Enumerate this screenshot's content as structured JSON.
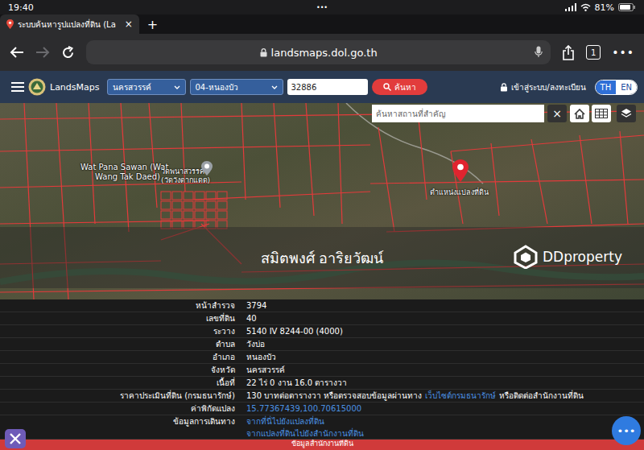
{
  "status_bar": {
    "time": "19:40",
    "dots": "•••",
    "battery": "81%"
  },
  "browser": {
    "tab": {
      "label": "ระบบค้นหารูปแปลงที่ดิน (La",
      "close": "×",
      "selected": true
    },
    "new_tab": "+",
    "forward_disabled": true,
    "url": "landsmaps.dol.go.th",
    "tab_count": "1",
    "more": "•••"
  },
  "header": {
    "brand": "LandsMaps",
    "province": "นครสวรรค์",
    "district": "04-หนองบัว",
    "parcel_no": "32886",
    "search_button": "ค้นหา",
    "login": "เข้าสู่ระบบ/ลงทะเบียน",
    "languages": [
      {
        "label": "TH",
        "selected": true
      },
      {
        "label": "EN",
        "selected": false
      }
    ]
  },
  "map": {
    "search_placeholder": "ค้นหาสถานที่สำคัญ",
    "clear": "×",
    "labels": [
      "Wat Pana Sawan (Wat",
      "Wang Tak Daed)",
      "วัดพนาสวรรค์",
      "(วัดวังตากแดด)"
    ],
    "marker_label": "ตำแหน่งแปลงที่ดิน",
    "watermark": "สมิตพงศ์ อาริยวัฒน์",
    "logo": "DDproperty"
  },
  "details": [
    {
      "label": "หน้าสำรวจ",
      "kind": "inline",
      "value": [
        {
          "text": "3794",
          "link": false
        }
      ]
    },
    {
      "label": "เลขที่ดิน",
      "kind": "inline",
      "value": [
        {
          "text": "40",
          "link": false
        }
      ]
    },
    {
      "label": "ระวาง",
      "kind": "inline",
      "value": [
        {
          "text": "5140 IV 8244-00 (4000)",
          "link": false
        }
      ]
    },
    {
      "label": "ตำบล",
      "kind": "inline",
      "value": [
        {
          "text": "วังบ่อ",
          "link": false
        }
      ]
    },
    {
      "label": "อำเภอ",
      "kind": "inline",
      "value": [
        {
          "text": "หนองบัว",
          "link": false
        }
      ]
    },
    {
      "label": "จังหวัด",
      "kind": "inline",
      "value": [
        {
          "text": "นครสวรรค์",
          "link": false
        }
      ]
    },
    {
      "label": "เนื้อที่",
      "kind": "inline",
      "value": [
        {
          "text": "22 ไร่ 0 งาน 16.0 ตารางวา",
          "link": false
        }
      ]
    },
    {
      "label": "ราคาประเมินที่ดิน (กรมธนารักษ์)",
      "kind": "inline",
      "value": [
        {
          "text": "130 บาทต่อตารางวา หรือตรวจสอบข้อมูลผ่านทาง",
          "link": false
        },
        {
          "text": "เว็บไซต์กรมธนารักษ์",
          "link": true
        },
        {
          "text": "หรือติดต่อสำนักงานที่ดิน",
          "link": false
        }
      ]
    },
    {
      "label": "ค่าพิกัดแปลง",
      "kind": "inline",
      "value": [
        {
          "text": "15.77367439,100.70615000",
          "link": true
        }
      ]
    },
    {
      "label": "ข้อมูลการเดินทาง",
      "kind": "stacked",
      "value": [
        {
          "text": "จากที่นี่ไปยังแปลงที่ดิน",
          "link": true
        },
        {
          "text": "จากแปลงที่ดินไปยังสำนักงานที่ดิน",
          "link": true
        }
      ]
    }
  ],
  "footer_bar": "ข้อมูลสำนักงานที่ดิน",
  "chat_button": "•••"
}
